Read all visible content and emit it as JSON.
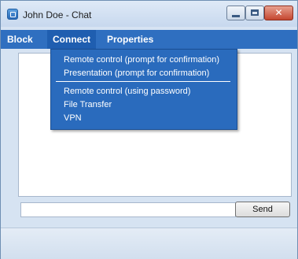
{
  "window": {
    "title": "John Doe - Chat",
    "close_glyph": "✕"
  },
  "menu": {
    "items": [
      "Block",
      "Connect",
      "Properties"
    ],
    "active": "Connect"
  },
  "dropdown": {
    "items": [
      "Remote control (prompt for confirmation)",
      "Presentation (prompt for confirmation)",
      "Remote control (using password)",
      "File Transfer",
      "VPN"
    ]
  },
  "chat": {
    "send_label": "Send",
    "message_value": ""
  },
  "colors": {
    "menubar": "#2f6fc0",
    "dropdown": "#2a6bbd",
    "window_bg": "#d6e3f2"
  }
}
